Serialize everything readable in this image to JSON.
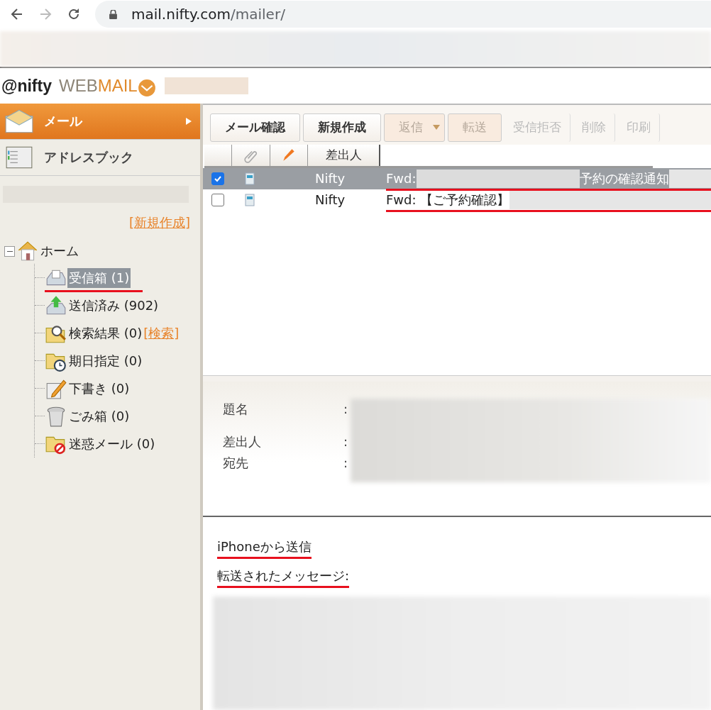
{
  "browser": {
    "url_host": "mail.nifty.com",
    "url_path": "/mailer/"
  },
  "header": {
    "logo_at": "@nifty",
    "logo_web": "WEB",
    "logo_mail": "MAIL"
  },
  "sidebar": {
    "nav": [
      {
        "label": "メール",
        "selected": true,
        "kind": "mail"
      },
      {
        "label": "アドレスブック",
        "selected": false,
        "kind": "book"
      }
    ],
    "new_folder_link": "[新規作成]",
    "tree": {
      "label": "ホーム",
      "expanded": true,
      "children": [
        {
          "label": "受信箱 (1)",
          "kind": "inbox",
          "selected": true,
          "underlined": true
        },
        {
          "label": "送信済み (902)",
          "kind": "sent",
          "selected": false,
          "underlined": false
        },
        {
          "label": "検索結果 (0)",
          "kind": "search",
          "selected": false,
          "underlined": false,
          "link": "[検索]"
        },
        {
          "label": "期日指定 (0)",
          "kind": "due",
          "selected": false,
          "underlined": false
        },
        {
          "label": "下書き (0)",
          "kind": "draft",
          "selected": false,
          "underlined": false
        },
        {
          "label": "ごみ箱 (0)",
          "kind": "trash",
          "selected": false,
          "underlined": false
        },
        {
          "label": "迷惑メール (0)",
          "kind": "spam",
          "selected": false,
          "underlined": false
        }
      ]
    }
  },
  "toolbar": [
    {
      "label": "メール確認",
      "disabled": false,
      "kind": "button"
    },
    {
      "label": "新規作成",
      "disabled": false,
      "kind": "button"
    },
    {
      "label": "返信",
      "disabled": true,
      "kind": "split"
    },
    {
      "label": "転送",
      "disabled": true,
      "kind": "button"
    },
    {
      "label": "受信拒否",
      "disabled": true,
      "kind": "plain"
    },
    {
      "label": "削除",
      "disabled": true,
      "kind": "plain"
    },
    {
      "label": "印刷",
      "disabled": true,
      "kind": "plain"
    }
  ],
  "table": {
    "columns": [
      {
        "kind": "check"
      },
      {
        "kind": "attach"
      },
      {
        "kind": "flag"
      },
      {
        "kind": "text",
        "label": "差出人"
      },
      {
        "kind": "blank"
      }
    ],
    "rows": [
      {
        "checked": true,
        "selected": true,
        "sender": "Nifty",
        "subject": [
          {
            "kind": "text",
            "text": "Fwd:"
          },
          {
            "kind": "redacted"
          },
          {
            "kind": "text",
            "text": "予約の確認通知"
          },
          {
            "kind": "redacted"
          }
        ]
      },
      {
        "checked": false,
        "selected": false,
        "sender": "Nifty",
        "subject": [
          {
            "kind": "text",
            "text": "Fwd: 【ご予約確認】"
          },
          {
            "kind": "redacted"
          }
        ]
      }
    ]
  },
  "preview": {
    "fields": [
      {
        "label": "題名",
        "sep": ":"
      },
      {
        "label": "差出人",
        "sep": ":"
      },
      {
        "label": "宛先",
        "sep": ":"
      }
    ],
    "body": [
      "iPhoneから送信",
      "転送されたメッセージ:"
    ]
  }
}
